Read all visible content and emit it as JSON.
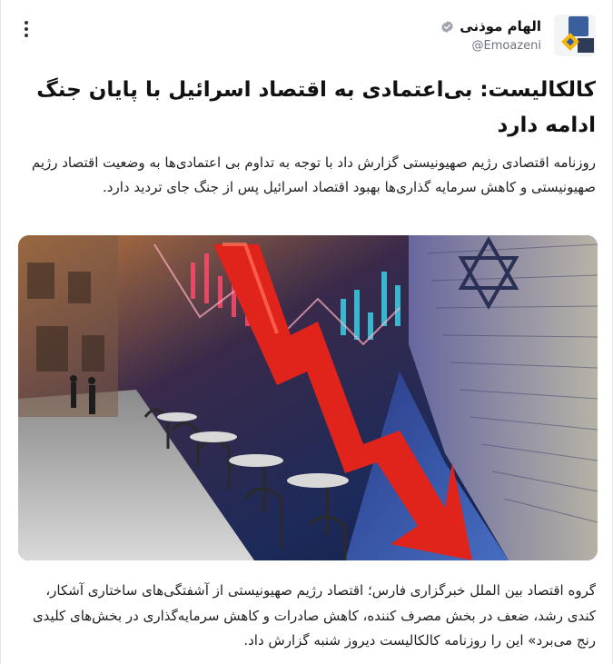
{
  "post": {
    "author_name": "الهام موذنی",
    "author_handle": "@Emoazeni",
    "verified_icon": "verified-badge-icon",
    "menu_icon": "more-vertical-icon",
    "title": "کالکالیست: بی‌اعتمادی به اقتصاد اسرائیل با پایان جنگ ادامه دارد",
    "lead": "روزنامه اقتصادی رژیم صهیونیستی گزارش داد با توجه به تداوم بی اعتمادی‌ها به وضعیت اقتصاد رژیم صهیونیستی و کاهش سرمایه گذاری‌ها بهبود اقتصاد اسرائیل پس از جنگ جای تردید دارد.",
    "image_description_icon": "stock-market-crash-photo",
    "body": "گروه اقتصاد بین الملل خبرگزاری فارس؛  اقتصاد رژیم صهیونیستی از آشفتگی‌های ساختاری آشکار، کندی رشد، ضعف در بخش مصرف کننده، کاهش صادرات و کاهش سرمایه‌گذاری در بخش‌های کلیدی رنج می‌برد» این را روزنامه کالکالیست دیروز شنبه گزارش داد."
  },
  "colors": {
    "text": "#1a1a1a",
    "handle": "#6b7280",
    "verified": "#9ca3af",
    "arrow_red": "#e0241b",
    "brand_yellow": "#f5b50a",
    "brand_blue": "#2f5aa8"
  }
}
